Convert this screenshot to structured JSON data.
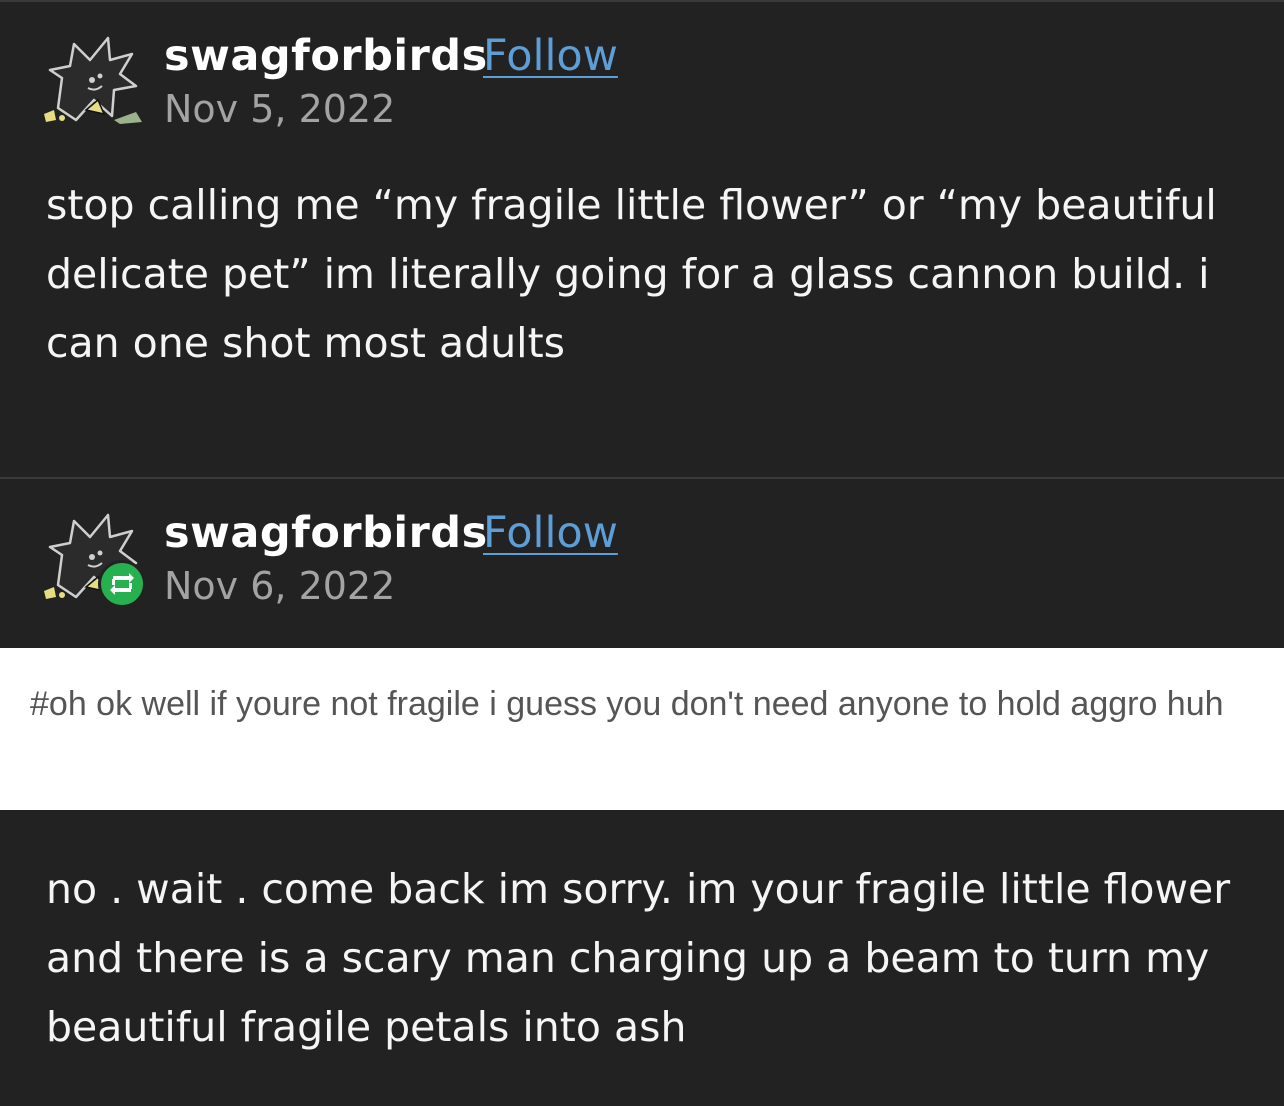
{
  "posts": [
    {
      "username": "swagforbirds",
      "follow_label": "Follow",
      "date": "Nov 5, 2022",
      "body": "stop calling me “my fragile little flower” or “my beautiful delicate pet” im literally going for a glass cannon build. i can one shot most adults",
      "avatar_icon": "bird-avatar-icon"
    },
    {
      "username": "swagforbirds",
      "follow_label": "Follow",
      "date": "Nov 6, 2022",
      "tags": "#oh ok well if youre not fragile i guess you don't need anyone to hold aggro huh",
      "body": "no . wait . come back im sorry. im your fragile little flower and there is a scary man charging up a beam to turn my beautiful fragile petals into ash",
      "avatar_icon": "bird-avatar-icon",
      "badge_icon": "reblog-icon"
    }
  ],
  "colors": {
    "background": "#222222",
    "follow_link": "#5e9ed6",
    "date": "#a3a3a3",
    "reblog_badge": "#27b04f",
    "tags_background": "#ffffff"
  }
}
